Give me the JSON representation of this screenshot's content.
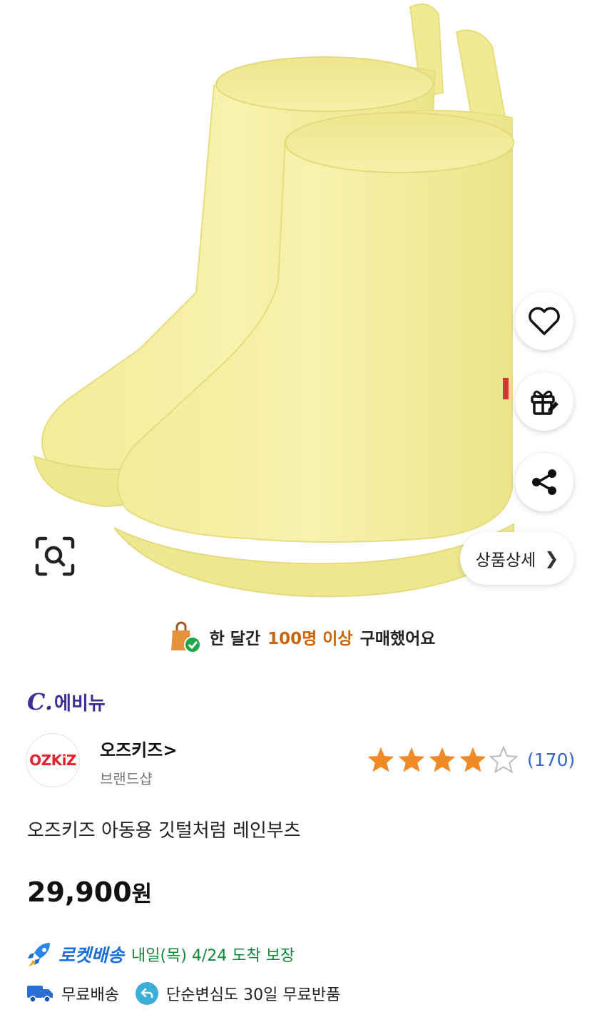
{
  "hero": {
    "detail_button_label": "상품상세"
  },
  "purchase_banner": {
    "prefix": "한 달간",
    "highlight": "100명 이상",
    "suffix": "구매했어요"
  },
  "seller": {
    "logo_c": "C.",
    "logo_text": "에비뉴"
  },
  "brand": {
    "logo_text": "OZKiZ",
    "name": "오즈키즈",
    "name_chevron": ">",
    "sub": "브랜드샵"
  },
  "rating": {
    "stars": 4,
    "max": 5,
    "count": "(170)"
  },
  "product": {
    "title": "오즈키즈 아동용 깃털처럼 레인부츠",
    "price_number": "29,900",
    "price_unit": "원"
  },
  "delivery": {
    "rocket_label": "로켓배송",
    "arrival": "내일(목) 4/24 도착 보장",
    "free_shipping": "무료배송",
    "free_return": "단순변심도 30일 무료반품"
  },
  "colors": {
    "boot_yellow": "#f4ef9e",
    "highlight_orange": "#c8640c",
    "rocket_blue": "#1b6fd8",
    "arrival_green": "#0f8a3a",
    "star_orange": "#f08a24",
    "count_blue": "#3567c8"
  }
}
